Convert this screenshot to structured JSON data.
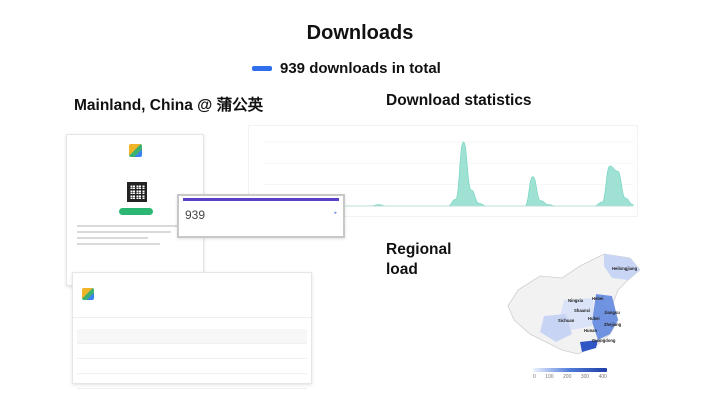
{
  "slide": {
    "title": "Downloads",
    "legend_text": "939 downloads in total",
    "accent_color": "#2f6fed"
  },
  "sections": {
    "left_label": "Mainland, China @ 蒲公英",
    "stats_label": "Download statistics",
    "region_label": "Regional load"
  },
  "screenshot": {
    "count_value": "939",
    "brand_color": "#5b3fc4",
    "install_color": "#2bb673"
  },
  "chart_data": {
    "type": "area",
    "series": [
      {
        "values": [
          0,
          0,
          0,
          0,
          0,
          0,
          0,
          0,
          0,
          0,
          0,
          0,
          0,
          0,
          0,
          1,
          0,
          0,
          0,
          0,
          0,
          0,
          0,
          0,
          0,
          5,
          48,
          12,
          2,
          0,
          0,
          0,
          0,
          0,
          0,
          22,
          4,
          1,
          0,
          0,
          0,
          0,
          0,
          0,
          3,
          30,
          26,
          6,
          1
        ]
      }
    ],
    "color": "#7fd8c6",
    "grid": true
  },
  "map": {
    "regions": [
      "Heilongjiang",
      "Ningxia",
      "Hebei",
      "Shaanxi",
      "Jiangsu",
      "Sichuan",
      "Hubei",
      "Zhejiang",
      "Hunan",
      "Guangdong"
    ],
    "legend_ticks": [
      "0",
      "100",
      "200",
      "300",
      "400"
    ],
    "scale_colors": [
      "#eef2ff",
      "#4f7bd8",
      "#1f3fa6"
    ]
  }
}
